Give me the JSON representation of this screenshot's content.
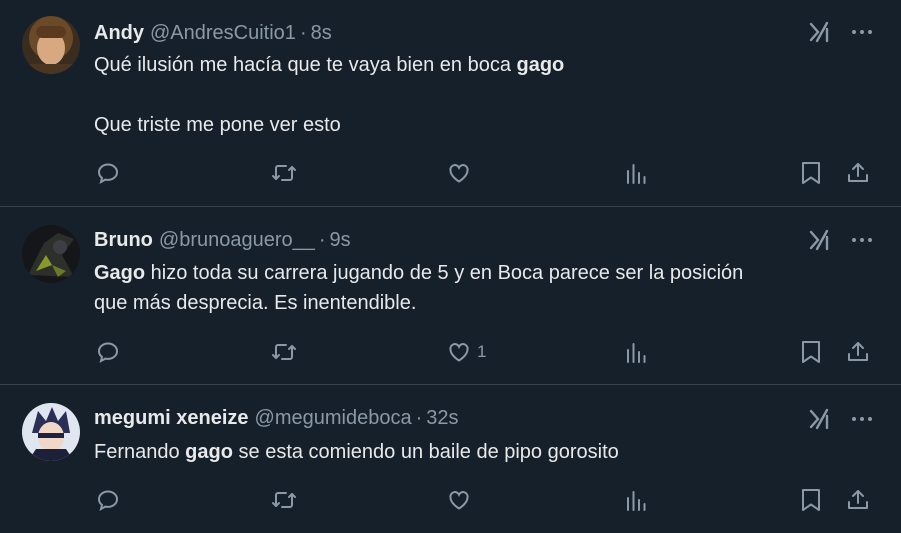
{
  "colors": {
    "background": "#15202b",
    "divider": "#38444d",
    "text": "#e7e9ea",
    "muted": "#8b98a5"
  },
  "tweets": [
    {
      "name": "Andy",
      "handle": "@AndresCuitio1",
      "separator": "·",
      "time": "8s",
      "body": [
        {
          "text": "Qué ilusión me hacía que te vaya bien en boca ",
          "bold": false
        },
        {
          "text": "gago",
          "bold": true
        },
        {
          "text": "\n\nQue triste me pone ver esto",
          "bold": false
        }
      ],
      "like_count": ""
    },
    {
      "name": "Bruno",
      "handle": "@brunoaguero__",
      "separator": "·",
      "time": "9s",
      "body": [
        {
          "text": "Gago",
          "bold": true
        },
        {
          "text": " hizo toda su carrera jugando de 5 y en Boca parece ser la posición\nque más desprecia. Es inentendible.",
          "bold": false
        }
      ],
      "like_count": "1"
    },
    {
      "name": "megumi xeneize",
      "handle": "@megumideboca",
      "separator": "·",
      "time": "32s",
      "body": [
        {
          "text": "Fernando ",
          "bold": false
        },
        {
          "text": "gago",
          "bold": true
        },
        {
          "text": " se esta comiendo un baile de pipo gorosito",
          "bold": false
        }
      ],
      "like_count": ""
    }
  ],
  "icons": {
    "grok": "grok-icon",
    "more": "more-icon",
    "reply": "reply-icon",
    "retweet": "retweet-icon",
    "like": "like-icon",
    "views": "views-icon",
    "bookmark": "bookmark-icon",
    "share": "share-icon"
  }
}
